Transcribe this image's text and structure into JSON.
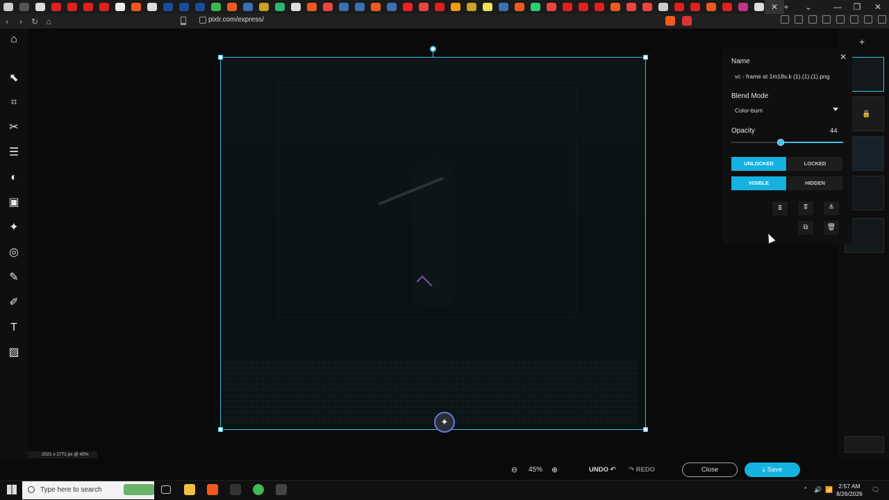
{
  "browser": {
    "url": "pixlr.com/express/"
  },
  "canvas": {
    "info": "2021 x 1771 px @ 45%"
  },
  "layer_panel": {
    "name_label": "Name",
    "name_value": "vc - frame at 1m18s.k (1).(1).(1).png",
    "blend_label": "Blend Mode",
    "blend_value": "Color-burn",
    "opacity_label": "Opacity",
    "opacity_value": "44",
    "opacity": 44,
    "lock_options": [
      "UNLOCKED",
      "LOCKED"
    ],
    "visibility_options": [
      "VISIBLE",
      "HIDDEN"
    ]
  },
  "bottom": {
    "zoom": "45%",
    "undo": "UNDO",
    "redo": "REDO",
    "close": "Close",
    "save": "Save"
  },
  "taskbar": {
    "search_placeholder": "Type here to search",
    "time": "2:57 AM",
    "date": "8/26/2026"
  },
  "colors": {
    "accent": "#15b1e0",
    "selection": "#3ec2e6"
  }
}
